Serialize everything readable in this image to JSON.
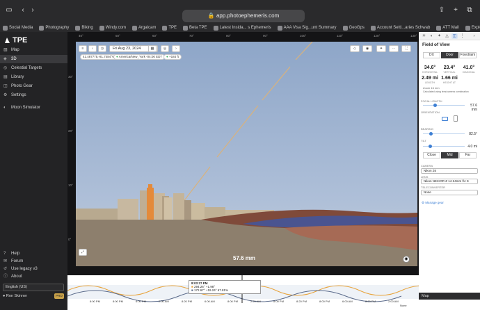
{
  "browser": {
    "url": "app.photoephemeris.com",
    "bookmarks": [
      "Social Media",
      "Photography",
      "Biking",
      "Windy.com",
      "Argalcam",
      "TPE",
      "Beta TPE",
      "Latest Insida... s Ephemeris",
      "AAA Visa Sig...unt Summary",
      "GeoGps",
      "Account Setti...aries Schwab",
      "ATT Mail",
      "Explore | Monarium"
    ]
  },
  "sidebar": {
    "app_name": "TPE",
    "items": [
      {
        "label": "Map",
        "icon": "map-icon"
      },
      {
        "label": "3D",
        "icon": "cube-icon"
      },
      {
        "label": "Celestial Targets",
        "icon": "target-icon"
      },
      {
        "label": "Library",
        "icon": "library-icon"
      },
      {
        "label": "Photo Gear",
        "icon": "camera-icon"
      },
      {
        "label": "Settings",
        "icon": "gear-icon"
      }
    ],
    "extra_item": {
      "label": "Moon Simulator",
      "icon": "moon-icon"
    },
    "bottom_items": [
      {
        "label": "Help",
        "icon": "help-icon"
      },
      {
        "label": "Forum",
        "icon": "forum-icon"
      },
      {
        "label": "Use legacy v3",
        "icon": "legacy-icon"
      },
      {
        "label": "About",
        "icon": "info-icon"
      }
    ],
    "language": "English (US)",
    "user_name": "Ron Skinner",
    "user_badge": "PRO"
  },
  "viewer": {
    "date": "Fri Aug 23, 2024",
    "coords": "41.487775,-81.7484°W",
    "timezone": "America/New_York -04:00 EDT",
    "elevation": "+184 ft",
    "focal_length_display": "57.6 mm"
  },
  "panel": {
    "title": "Field of View",
    "orientation_options": [
      "DX",
      "Door",
      "Fixed/aim"
    ],
    "orientation_selected": "Door",
    "values": [
      {
        "value": "34.6°",
        "caption": "HORIZONTAL"
      },
      {
        "value": "23.4°",
        "caption": "VERTICAL"
      },
      {
        "value": "41.0°",
        "caption": "DIAGONAL"
      },
      {
        "value": "2.49 mi",
        "caption": "LENGTH"
      },
      {
        "value": "1.66 mi",
        "caption": "HEIGHT AT"
      }
    ],
    "zoom_label": "Zoom",
    "zoom_value": "16 mm",
    "note": "Calculated using lens/camera combination",
    "focal_length_label": "FOCAL LENGTH",
    "focal_length_value": "57.6 mm",
    "orientation_label": "ORIENTATION",
    "bearing_label": "BEARING",
    "bearing_value": "82.5°",
    "tilt_label": "TILT",
    "tilt_value": "4.0 mi",
    "depth_options": [
      "Close",
      "Mid",
      "Far"
    ],
    "depth_selected": "Mid",
    "camera_label": "CAMERA",
    "camera_value": "Nikon Z6",
    "lens_label": "LENS",
    "lens_value": "Nikon NIKKOR Z 14-24mm f/4 S",
    "teleconverter_label": "TELECONVERTER",
    "teleconverter_value": "None",
    "manage_gear": "Manage gear"
  },
  "timeline": {
    "tooltip_time": "8:03:27 PM",
    "tooltip_rows": [
      {
        "az": "294.26°",
        "alt": "+1.98°",
        "extra": ""
      },
      {
        "az": "172.67°",
        "alt": "+19.24°",
        "extra": "67.81%"
      }
    ],
    "ticks": [
      "8:00 PM",
      "8:00 PM",
      "6:00 PM",
      "2:00 AM",
      "8:20 PM",
      "6:00 AM",
      "8:00 PM",
      "2:20 AM",
      "8:00 PM",
      "8:20 PM",
      "8:00 PM",
      "6:00 AM",
      "8:20 PM",
      "2:00 AM"
    ],
    "none_label": "None"
  },
  "map_bar": {
    "label": "Map"
  },
  "ruler_labels": {
    "top": [
      "40°",
      "50°",
      "60°",
      "70°",
      "80°",
      "90°",
      "100°",
      "110°",
      "120°",
      "130°"
    ],
    "left": [
      "30°",
      "20°",
      "10°",
      "0°"
    ]
  }
}
